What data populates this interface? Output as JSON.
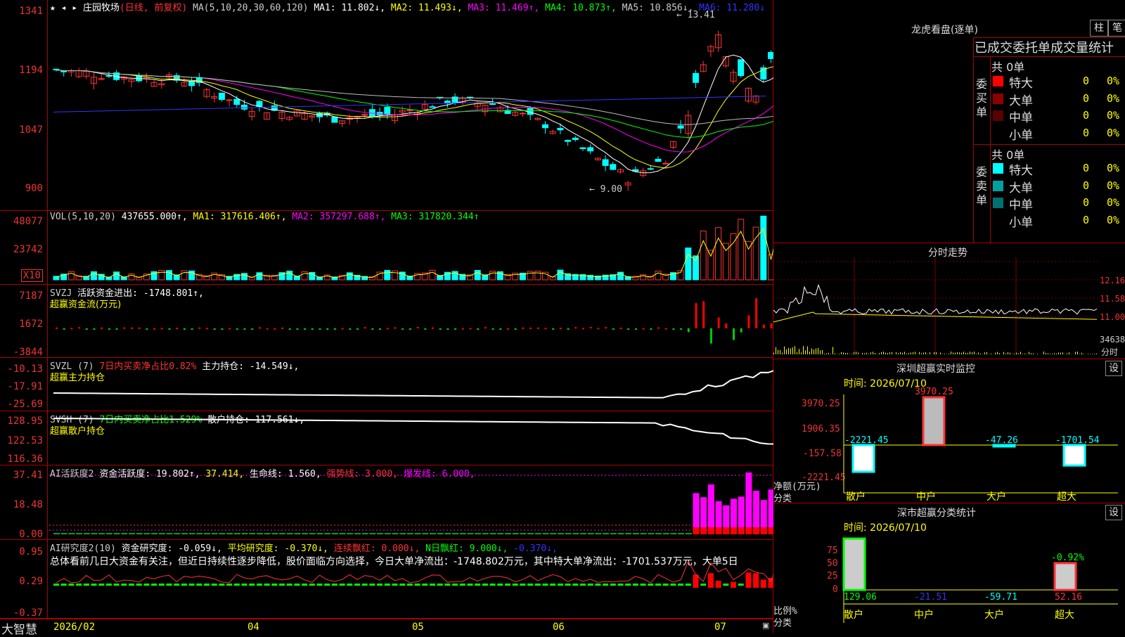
{
  "main_chart": {
    "stock_name": "庄园牧场",
    "mode": "(日线, 前复权)",
    "ma_label": "MA(5,10,20,30,60,120)",
    "ma1": "MA1: 11.802↓,",
    "ma2": "MA2: 11.493↓,",
    "ma3": "MA3: 11.469↑,",
    "ma4": "MA4: 10.873↑,",
    "ma5": "MA5: 10.856↓,",
    "ma6": "MA6: 11.280↓",
    "y_ticks": [
      "1341",
      "1194",
      "1047",
      "900"
    ],
    "high_marker": "13.41",
    "low_marker": "9.00"
  },
  "vol_panel": {
    "label": "VOL(5,10,20)",
    "value": "437655.000↑,",
    "ma1": "MA1: 317616.406↑,",
    "ma2": "MA2: 357297.688↑,",
    "ma3": "MA3: 317820.344↑",
    "y_ticks": [
      "48077",
      "23742"
    ],
    "unit": "X10"
  },
  "svzj_panel": {
    "label": "SVZJ",
    "value": "活跃资金进出: -1748.801↑,",
    "subtitle": "超赢资金流(万元)",
    "y_ticks": [
      "7187",
      "1672",
      "-3844"
    ]
  },
  "svzl_panel": {
    "label": "SVZL (7)",
    "ratio": "7日内买卖净占比0.82%",
    "value": "主力持仓: -14.549↓,",
    "subtitle": "超赢主力持仓",
    "y_ticks": [
      "-10.13",
      "-17.91",
      "-25.69"
    ]
  },
  "svsh_panel": {
    "label": "SVSH (7)",
    "ratio": "7日内买卖净占比1.529%",
    "value": "散户持仓: 117.561↓,",
    "subtitle": "超赢散户持仓",
    "y_ticks": [
      "128.95",
      "122.53",
      "116.36"
    ]
  },
  "ai_active": {
    "label": "AI活跃度2",
    "a": "资金活跃度: 19.802↑,",
    "b": "37.414,",
    "c": "生命线: 1.560,",
    "d": "强势线: 3.000,",
    "e": "爆发线: 6.000,",
    "y_ticks": [
      "37.41",
      "18.48",
      "0.00"
    ]
  },
  "ai_research": {
    "label": "AI研究度2(10)",
    "a": "资金研究度: -0.059↓,",
    "b": "平均研究度: -0.370↓,",
    "c": "连续飘红: 0.000↓,",
    "d": "N日飘红: 9.000↓,",
    "e": "-0.370↓,",
    "commentary": "总体看前几日大资金有关注，但近日持续性逐步降低，股价面临方向选择，今日大单净流出：-1748.802万元，其中特大单净流出：-1701.537万元，大单5日",
    "y_ticks": [
      "0.95",
      "0.29",
      "-0.37"
    ]
  },
  "footer": {
    "brand": "大智慧",
    "dates": [
      "2026/02",
      "04",
      "05",
      "06",
      "07"
    ]
  },
  "dragon_tiger": {
    "title": "龙虎看盘(逐单)",
    "btn_column": "柱",
    "btn_pen": "笔",
    "tab_label": "已成交委托单成交量统计",
    "buy_label": "委买单",
    "sell_label": "委卖单",
    "buy_total": "共 0单",
    "sell_total": "共 0单",
    "buy_rows": [
      {
        "label": "特大",
        "count": "0",
        "pct": "0%",
        "color": "#ff0000"
      },
      {
        "label": "大单",
        "count": "0",
        "pct": "0%",
        "color": "#8b0000"
      },
      {
        "label": "中单",
        "count": "0",
        "pct": "0%",
        "color": "#5a0000"
      },
      {
        "label": "小单",
        "count": "0",
        "pct": "0%",
        "color": "#000000"
      }
    ],
    "sell_rows": [
      {
        "label": "特大",
        "count": "0",
        "pct": "0%",
        "color": "#00ffff"
      },
      {
        "label": "大单",
        "count": "0",
        "pct": "0%",
        "color": "#00a0a0"
      },
      {
        "label": "中单",
        "count": "0",
        "pct": "0%",
        "color": "#007070"
      },
      {
        "label": "小单",
        "count": "0",
        "pct": "0%",
        "color": "#000000"
      }
    ]
  },
  "intraday": {
    "title": "分时走势",
    "y_ticks": [
      "12.16",
      "11.58",
      "11.00"
    ],
    "vol_tick": "34638",
    "time_label": "分时"
  },
  "sz_monitor": {
    "title": "深圳超赢实时监控",
    "btn": "设",
    "time": "时间: 2026/07/10",
    "y_ticks": [
      "3970.25",
      "1906.35",
      "-157.58",
      "-2221.45"
    ],
    "net_label": "净额(万元)",
    "cat_label": "分类",
    "categories": [
      "散户",
      "中户",
      "大户",
      "超大"
    ],
    "values": [
      "-2221.45",
      "3970.25",
      "-47.26",
      "-1701.54"
    ]
  },
  "sz_classify": {
    "title": "深市超赢分类统计",
    "btn": "设",
    "time": "时间: 2026/07/10",
    "y_ticks": [
      "75",
      "50",
      "25",
      "0"
    ],
    "ratio_label": "比例%",
    "cat_label": "分类",
    "categories": [
      "散户",
      "中户",
      "大户",
      "超大"
    ],
    "values": [
      "129.06",
      "-21.51",
      "-59.71",
      "52.16"
    ],
    "top_label": "-0.92%"
  },
  "chart_data": {
    "type": "bar",
    "title": "深圳超赢实时监控",
    "categories": [
      "散户",
      "中户",
      "大户",
      "超大"
    ],
    "values": [
      -2221.45,
      3970.25,
      -47.26,
      -1701.54
    ],
    "ylabel": "净额(万元)",
    "ylim": [
      -2221.45,
      3970.25
    ]
  }
}
